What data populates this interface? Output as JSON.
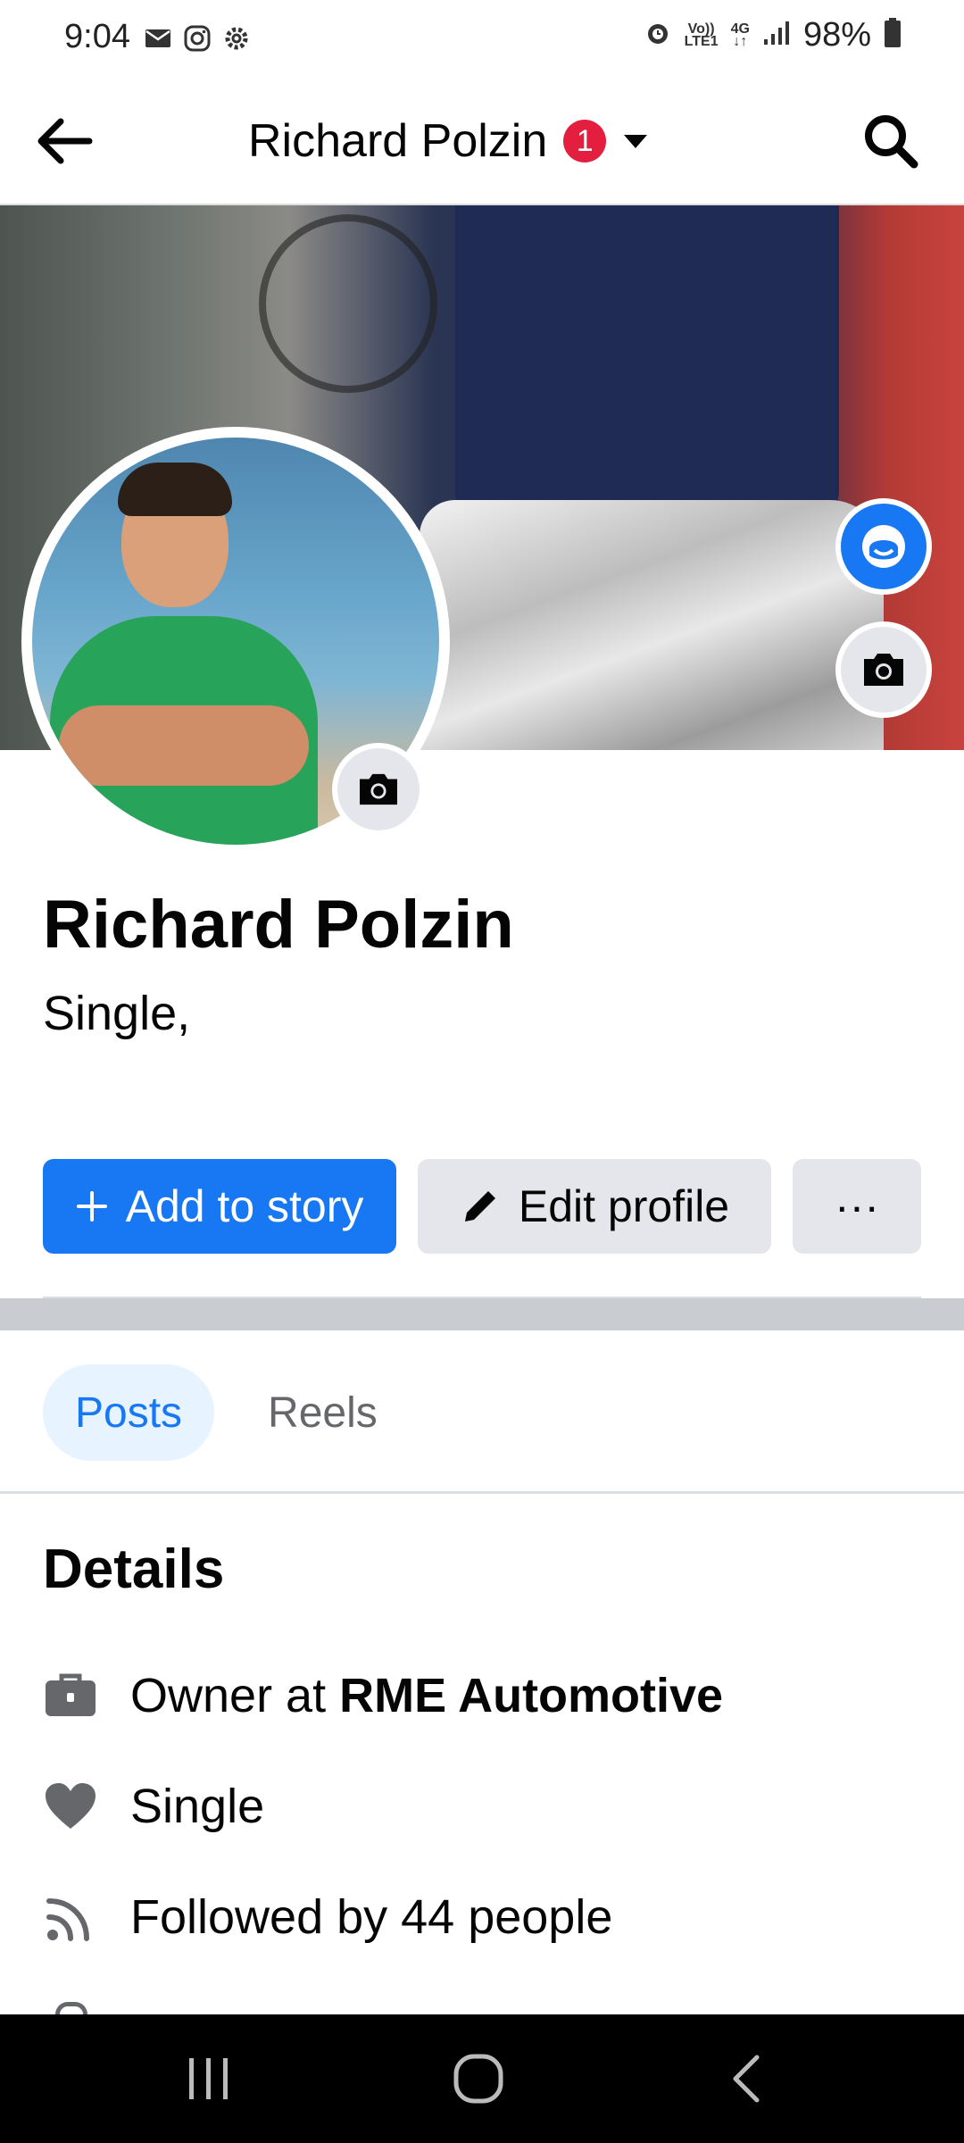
{
  "status_bar": {
    "time": "9:04",
    "battery": "98%",
    "volte_top": "Vo))",
    "volte_bottom": "LTE1",
    "network": "4G",
    "left_icons": [
      "mail-icon",
      "instagram-icon",
      "settings-icon"
    ],
    "right_icons": [
      "alarm-icon",
      "signal-icon",
      "battery-icon"
    ]
  },
  "header": {
    "title": "Richard Polzin",
    "notification_count": "1"
  },
  "profile": {
    "name": "Richard Polzin",
    "bio": "Single,"
  },
  "actions": {
    "add_story": "Add to story",
    "edit_profile": "Edit profile",
    "more": "···"
  },
  "tabs": [
    {
      "label": "Posts",
      "active": true
    },
    {
      "label": "Reels",
      "active": false
    }
  ],
  "details": {
    "title": "Details",
    "work_prefix": "Owner at ",
    "work_company": "RME Automotive",
    "relationship": "Single",
    "followers": "Followed by 44 people"
  },
  "colors": {
    "accent": "#1877f2",
    "badge": "#e41e3f",
    "button_gray": "#e4e6eb",
    "text_secondary": "#65676b",
    "divider": "#c9ccd1"
  }
}
